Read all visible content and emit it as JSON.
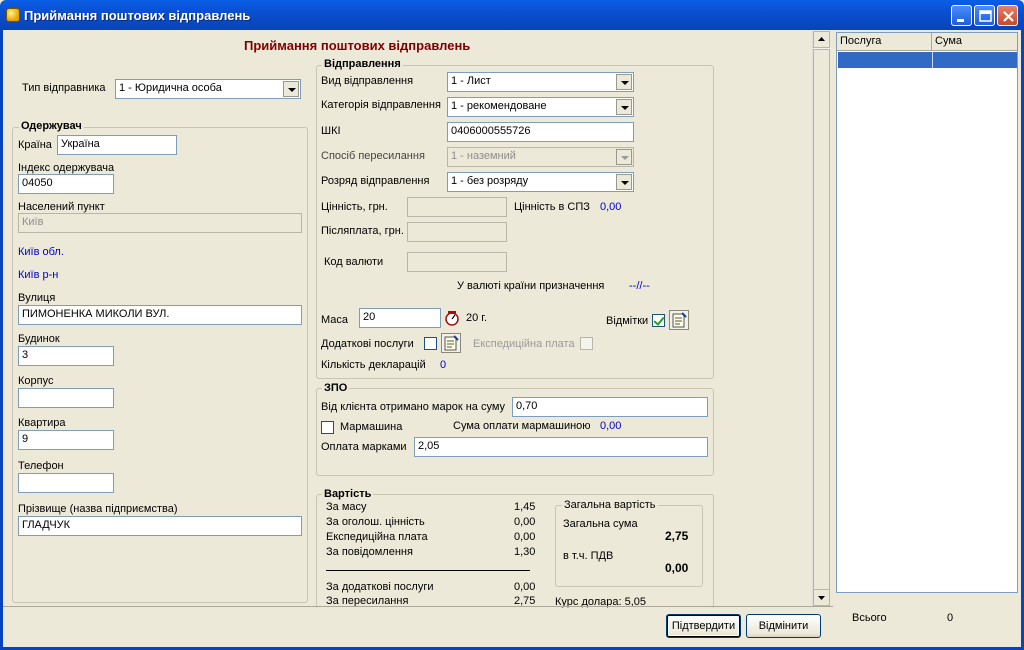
{
  "window": {
    "title": "Приймання поштових відправлень"
  },
  "form": {
    "heading": "Приймання поштових відправлень",
    "sender_type_label": "Тип відправника",
    "sender_type_value": "1 - Юридична особа"
  },
  "recipient": {
    "group_label": "Одержувач",
    "country_label": "Країна",
    "country_value": "Україна",
    "zip_label": "Індекс одержувача",
    "zip_value": "04050",
    "city_label": "Населений пункт",
    "city_value": "Київ",
    "region": "Київ обл.",
    "district": "Київ р-н",
    "street_label": "Вулиця",
    "street_value": "ПИМОНЕНКА МИКОЛИ ВУЛ.",
    "house_label": "Будинок",
    "house_value": "3",
    "building_label": "Корпус",
    "building_value": "",
    "apartment_label": "Квартира",
    "apartment_value": "9",
    "phone_label": "Телефон",
    "phone_value": "",
    "surname_label": "Прізвище  (назва підприємства)",
    "surname_value": "ГЛАДЧУК"
  },
  "shipment": {
    "group_label": "Відправлення",
    "type_label": "Вид відправлення",
    "type_value": "1 - Лист",
    "category_label": "Категорія відправлення",
    "category_value": "1 - рекомендоване",
    "barcode_label": "ШКІ",
    "barcode_value": "0406000555726",
    "method_label": "Спосіб пересилання",
    "method_value": "1 - наземний",
    "class_label": "Розряд відправлення",
    "class_value": "1 - без розряду",
    "value_label": "Цінність, грн.",
    "value_value": "",
    "spz_label": "Цінність в СПЗ",
    "spz_value": "0,00",
    "cod_label": "Післяплата, грн.",
    "cod_value": "",
    "currency_label": "Код валюти",
    "currency_value": "",
    "dest_currency_label": "У валюті країни призначення",
    "dest_currency_value": "--//--",
    "mass_label": "Маса",
    "mass_value": "20",
    "mass_unit": "20 г.",
    "marks_label": "Відмітки",
    "extra_services_label": "Додаткові послуги",
    "expedition_fee_label": "Експедиційна плата",
    "declarations_label": "Кількість декларацій",
    "declarations_value": "0"
  },
  "zpo": {
    "group_label": "ЗПО",
    "stamps_received_label": "Від клієнта отримано марок на суму",
    "stamps_received_value": "0,70",
    "franking_label": "Мармашина",
    "franking_sum_label": "Сума оплати мармашиною",
    "franking_sum_value": "0,00",
    "stamps_payment_label": "Оплата марками",
    "stamps_payment_value": "2,05"
  },
  "cost": {
    "group_label": "Вартість",
    "rows": [
      {
        "label": "За масу",
        "value": "1,45"
      },
      {
        "label": "За оголош. цінність",
        "value": "0,00"
      },
      {
        "label": "Експедиційна плата",
        "value": "0,00"
      },
      {
        "label": "За повідомлення",
        "value": "1,30"
      }
    ],
    "rows2": [
      {
        "label": "За додаткові послуги",
        "value": "0,00"
      },
      {
        "label": "За пересилання",
        "value": "2,75"
      }
    ],
    "total_group_label": "Загальна вартість",
    "total_label": "Загальна сума",
    "total_value": "2,75",
    "vat_label": "в т.ч. ПДВ",
    "vat_value": "0,00",
    "usd_rate": "Курс долара: 5,05"
  },
  "services_table": {
    "columns": [
      "Послуга",
      "Сума"
    ],
    "total_label": "Всього",
    "total_value": "0"
  },
  "buttons": {
    "confirm": "Підтвердити",
    "cancel": "Відмінити"
  }
}
